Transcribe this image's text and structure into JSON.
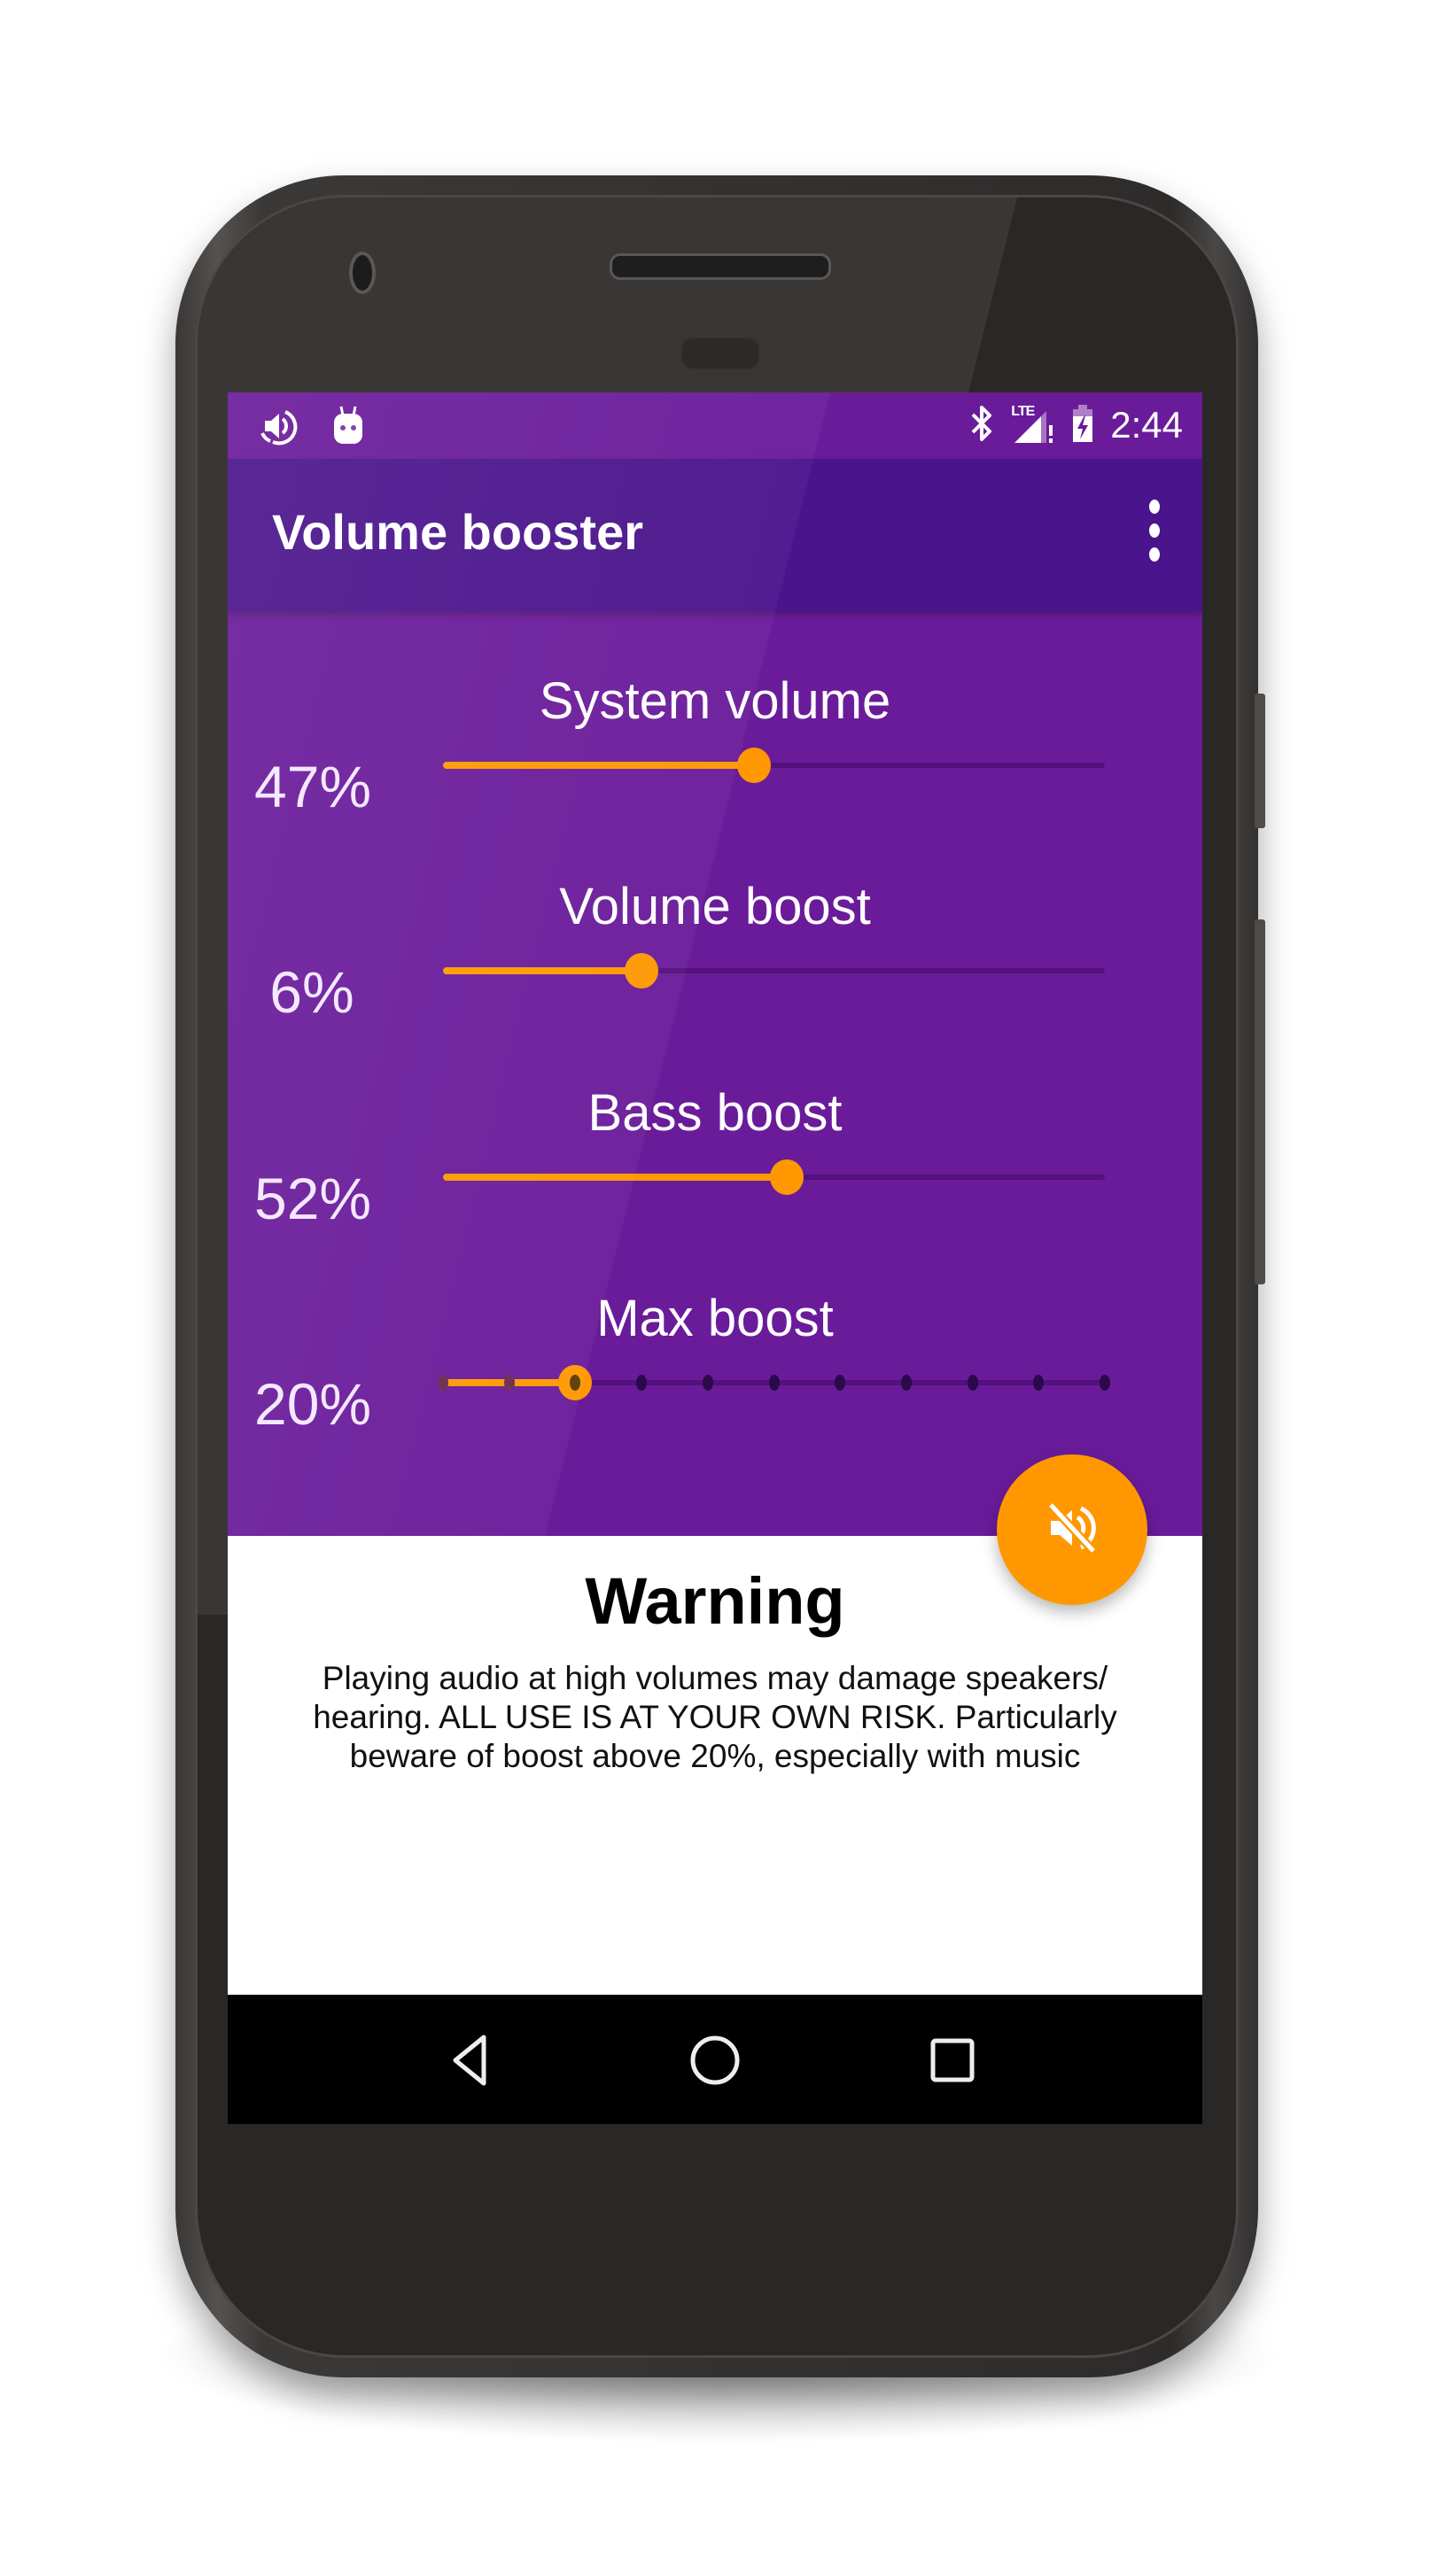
{
  "status_bar": {
    "left_icons": [
      "volume-boost-notification-icon",
      "android-notification-icon"
    ],
    "right_icons": [
      "bluetooth-icon",
      "lte-signal-icon",
      "battery-charging-icon"
    ],
    "network_label": "LTE",
    "time": "2:44"
  },
  "toolbar": {
    "title": "Volume booster",
    "overflow_icon": "more-vert-icon"
  },
  "controls": [
    {
      "label": "System volume",
      "value_text": "47%",
      "position": 0.47,
      "ticks": 0
    },
    {
      "label": "Volume boost",
      "value_text": "6%",
      "position": 0.3,
      "ticks": 0
    },
    {
      "label": "Bass boost",
      "value_text": "52%",
      "position": 0.52,
      "ticks": 0
    },
    {
      "label": "Max boost",
      "value_text": "20%",
      "position": 0.2,
      "ticks": 11
    }
  ],
  "fab": {
    "icon": "volume-off-icon"
  },
  "warning": {
    "title": "Warning",
    "body": "Playing audio at high volumes may damage speakers/ hearing. ALL USE IS AT YOUR OWN RISK. Particularly beware of boost above 20%, especially with music"
  },
  "nav_bar": {
    "buttons": [
      "back-icon",
      "home-icon",
      "recents-icon"
    ]
  },
  "colors": {
    "primary": "#6a1b9a",
    "primary_dark": "#4a148c",
    "accent": "#ff9800"
  }
}
